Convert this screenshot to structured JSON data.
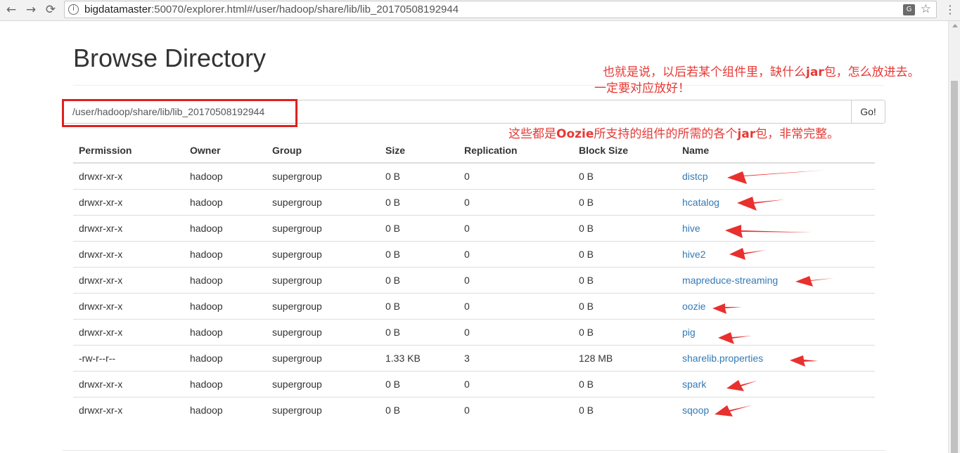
{
  "browser": {
    "url_host": "bigdatamaster",
    "url_rest": ":50070/explorer.html#/user/hadoop/share/lib/lib_20170508192944",
    "back_glyph": "←",
    "forward_glyph": "→",
    "reload_glyph": "⟳",
    "star_glyph": "☆",
    "menu_glyph": "⋮",
    "info_glyph": "i",
    "translate_glyph": "G"
  },
  "page": {
    "title": "Browse Directory",
    "path_value": "/user/hadoop/share/lib/lib_20170508192944",
    "go_label": "Go!"
  },
  "annotations": {
    "note1_line1": "也就是说，以后若某个组件里，缺什么",
    "note1_jar": "jar",
    "note1_line1_end": "包，怎么放进去。",
    "note1_line2": "一定要对应放好！",
    "note2_start": "这些都是",
    "note2_oozie": "Oozie",
    "note2_mid": "所支持的组件的所需的各个",
    "note2_jar": "jar",
    "note2_end": "包，非常完整。",
    "color": "#e53935"
  },
  "table": {
    "headers": [
      "Permission",
      "Owner",
      "Group",
      "Size",
      "Replication",
      "Block Size",
      "Name"
    ],
    "rows": [
      [
        "drwxr-xr-x",
        "hadoop",
        "supergroup",
        "0 B",
        "0",
        "0 B",
        "distcp"
      ],
      [
        "drwxr-xr-x",
        "hadoop",
        "supergroup",
        "0 B",
        "0",
        "0 B",
        "hcatalog"
      ],
      [
        "drwxr-xr-x",
        "hadoop",
        "supergroup",
        "0 B",
        "0",
        "0 B",
        "hive"
      ],
      [
        "drwxr-xr-x",
        "hadoop",
        "supergroup",
        "0 B",
        "0",
        "0 B",
        "hive2"
      ],
      [
        "drwxr-xr-x",
        "hadoop",
        "supergroup",
        "0 B",
        "0",
        "0 B",
        "mapreduce-streaming"
      ],
      [
        "drwxr-xr-x",
        "hadoop",
        "supergroup",
        "0 B",
        "0",
        "0 B",
        "oozie"
      ],
      [
        "drwxr-xr-x",
        "hadoop",
        "supergroup",
        "0 B",
        "0",
        "0 B",
        "pig"
      ],
      [
        "-rw-r--r--",
        "hadoop",
        "supergroup",
        "1.33 KB",
        "3",
        "128 MB",
        "sharelib.properties"
      ],
      [
        "drwxr-xr-x",
        "hadoop",
        "supergroup",
        "0 B",
        "0",
        "0 B",
        "spark"
      ],
      [
        "drwxr-xr-x",
        "hadoop",
        "supergroup",
        "0 B",
        "0",
        "0 B",
        "sqoop"
      ]
    ]
  }
}
